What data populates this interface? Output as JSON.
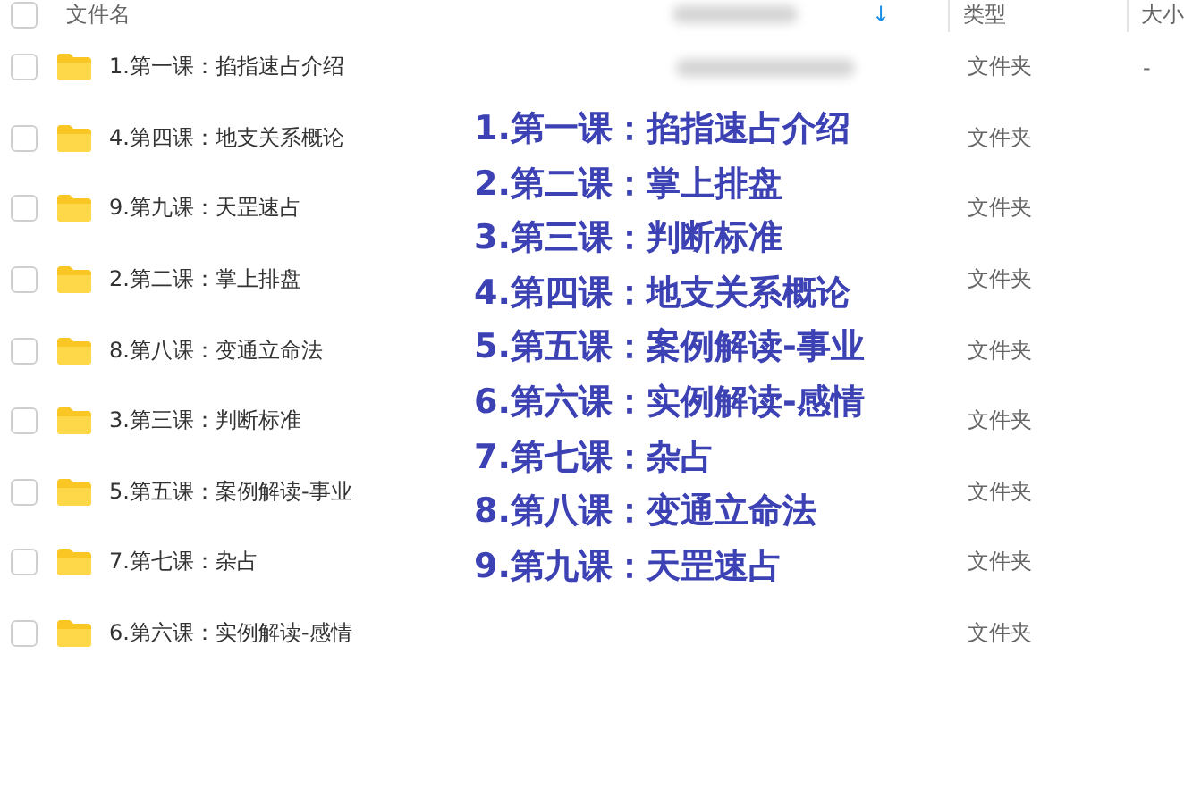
{
  "header": {
    "name": "文件名",
    "sort_icon": "↓",
    "type": "类型",
    "size": "大小",
    "checked": false
  },
  "rows": [
    {
      "name": "1.第一课：掐指速占介绍",
      "type": "文件夹",
      "size": "-",
      "checked": false
    },
    {
      "name": "4.第四课：地支关系概论",
      "type": "文件夹",
      "checked": false
    },
    {
      "name": "9.第九课：天罡速占",
      "type": "文件夹",
      "checked": false
    },
    {
      "name": "2.第二课：掌上排盘",
      "type": "文件夹",
      "checked": false
    },
    {
      "name": "8.第八课：变通立命法",
      "type": "文件夹",
      "checked": false
    },
    {
      "name": "3.第三课：判断标准",
      "type": "文件夹",
      "checked": false
    },
    {
      "name": "5.第五课：案例解读-事业",
      "type": "文件夹",
      "checked": false
    },
    {
      "name": "7.第七课：杂占",
      "type": "文件夹",
      "checked": false
    },
    {
      "name": "6.第六课：实例解读-感情",
      "type": "文件夹",
      "checked": false
    }
  ],
  "overlay_list": [
    "1.第一课：掐指速占介绍",
    "2.第二课：掌上排盘",
    "3.第三课：判断标准",
    "4.第四课：地支关系概论",
    "5.第五课：案例解读-事业",
    "6.第六课：实例解读-感情",
    "7.第七课：杂占",
    "8.第八课：变通立命法",
    "9.第九课：天罡速占"
  ]
}
